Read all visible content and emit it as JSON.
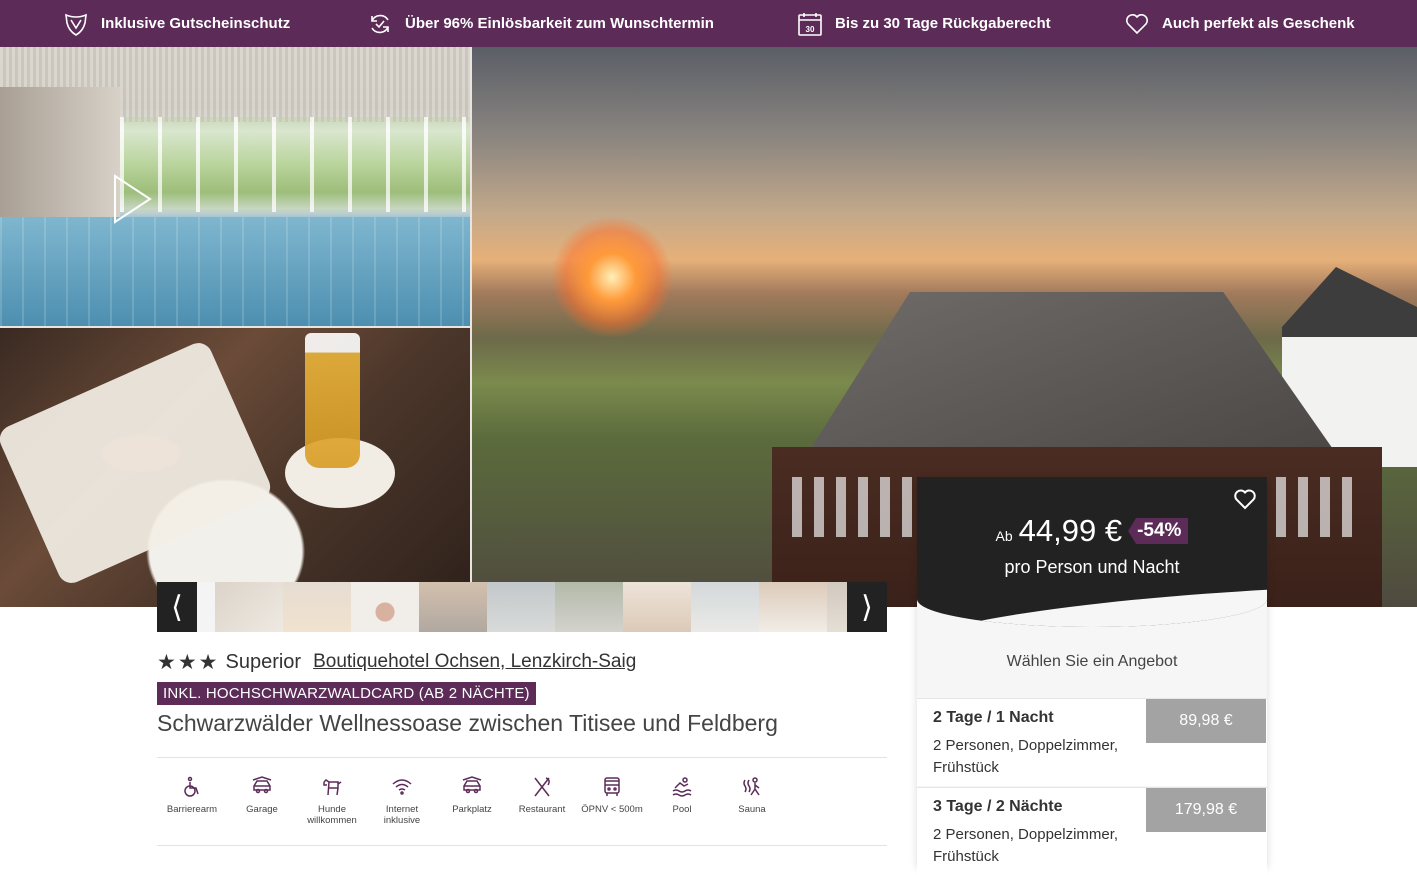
{
  "topbar": {
    "items": [
      {
        "icon": "shield-icon",
        "label": "Inklusive Gutscheinschutz"
      },
      {
        "icon": "refresh-check-icon",
        "label": "Über 96% Einlösbarkeit zum Wunschtermin"
      },
      {
        "icon": "calendar-icon",
        "label": "Bis zu 30 Tage Rückgaberecht",
        "calendar_day": "30"
      },
      {
        "icon": "heart-icon",
        "label": "Auch perfekt als Geschenk"
      }
    ]
  },
  "gallery": {
    "prev_arrow": "⟨",
    "next_arrow": "⟩",
    "thumbnail_count": 10
  },
  "hotel": {
    "category": "Superior",
    "star_count": 3,
    "star_glyph": "★",
    "name_link": "Boutiquehotel Ochsen, Lenzkirch-Saig",
    "badge": "INKL. HOCHSCHWARZWALDCARD (AB 2 NÄCHTE)",
    "headline": "Schwarzwälder Wellnessoase zwischen Titisee und Feldberg"
  },
  "amenities": [
    {
      "icon": "wheelchair-icon",
      "label": "Barrierearm"
    },
    {
      "icon": "car-icon",
      "label": "Garage"
    },
    {
      "icon": "dog-icon",
      "label": "Hunde willkommen"
    },
    {
      "icon": "wifi-icon",
      "label": "Internet inklusive"
    },
    {
      "icon": "car-icon",
      "label": "Parkplatz"
    },
    {
      "icon": "cutlery-icon",
      "label": "Restaurant"
    },
    {
      "icon": "bus-icon",
      "label": "ÖPNV < 500m"
    },
    {
      "icon": "pool-icon",
      "label": "Pool"
    },
    {
      "icon": "sauna-icon",
      "label": "Sauna"
    }
  ],
  "price_card": {
    "prefix": "Ab",
    "price": "44,99 €",
    "discount": "-54%",
    "subtitle": "pro Person und Nacht",
    "choose_label": "Wählen Sie ein Angebot",
    "offers": [
      {
        "title": "2 Tage / 1 Nacht",
        "desc": "2 Personen, Doppelzimmer, Frühstück",
        "price": "89,98 €"
      },
      {
        "title": "3 Tage / 2 Nächte",
        "desc": "2 Personen, Doppelzimmer, Frühstück",
        "price": "179,98 €"
      }
    ]
  },
  "colors": {
    "brand_purple": "#5c2b58",
    "dark": "#222222",
    "offer_price_bg": "#a3a3a3"
  }
}
